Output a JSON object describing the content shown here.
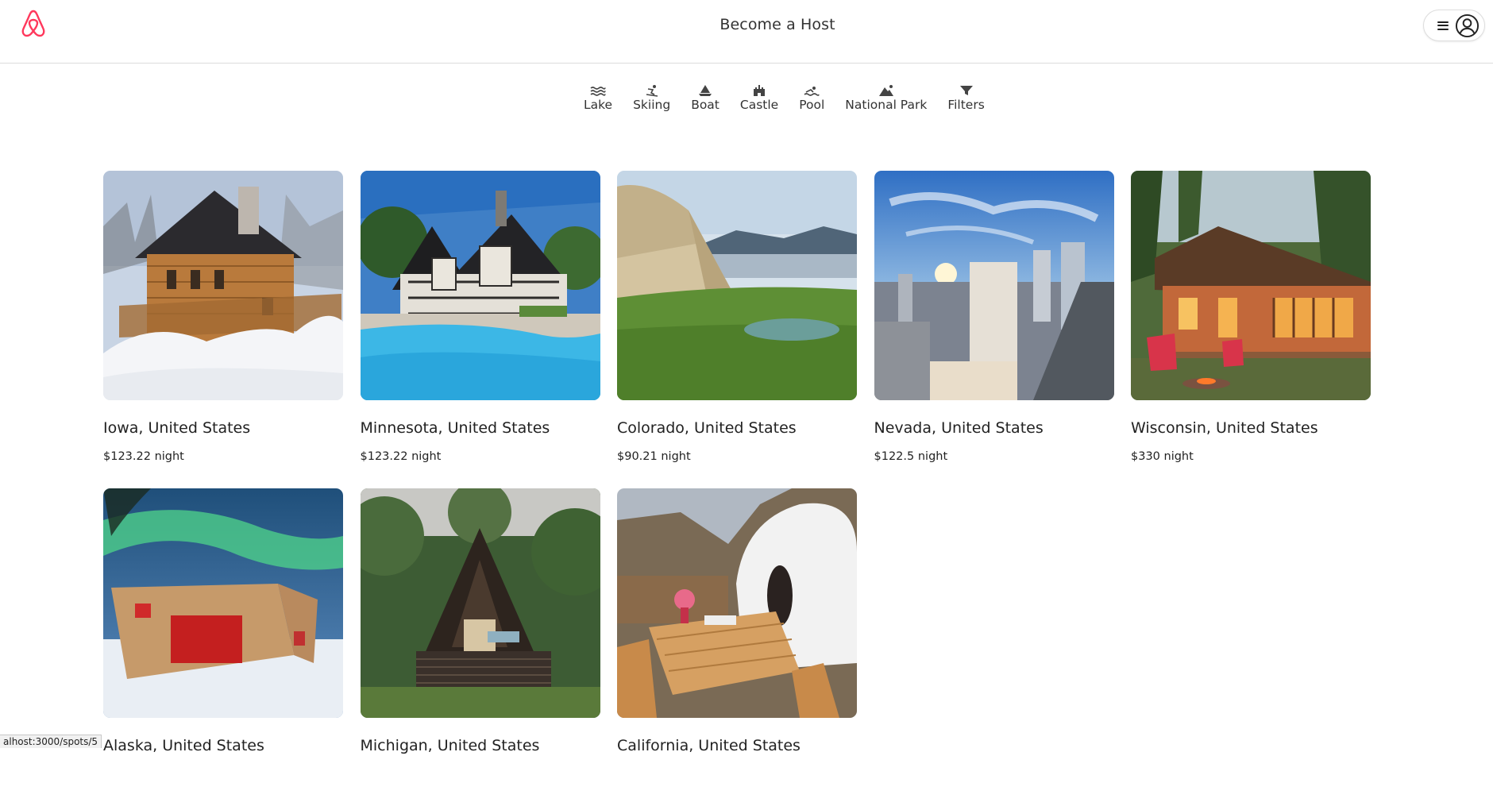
{
  "header": {
    "logo": "airbnb-logo",
    "host_link": "Become a Host"
  },
  "categories": [
    {
      "label": "Lake",
      "icon": "lake-icon"
    },
    {
      "label": "Skiing",
      "icon": "skiing-icon"
    },
    {
      "label": "Boat",
      "icon": "boat-icon"
    },
    {
      "label": "Castle",
      "icon": "castle-icon"
    },
    {
      "label": "Pool",
      "icon": "pool-icon"
    },
    {
      "label": "National Park",
      "icon": "national-park-icon"
    },
    {
      "label": "Filters",
      "icon": "filter-icon"
    }
  ],
  "listings": [
    {
      "location": "Iowa, United States",
      "price": "$123.22 night",
      "image": "snowy log cabin"
    },
    {
      "location": "Minnesota, United States",
      "price": "$123.22 night",
      "image": "tudor mansion with pool"
    },
    {
      "location": "Colorado, United States",
      "price": "$90.21 night",
      "image": "canvas tent by lake"
    },
    {
      "location": "Nevada, United States",
      "price": "$122.5 night",
      "image": "city skyline at sunset"
    },
    {
      "location": "Wisconsin, United States",
      "price": "$330 night",
      "image": "cabin with red chairs"
    },
    {
      "location": "Alaska, United States",
      "price": "",
      "image": "modern cabin under aurora"
    },
    {
      "location": "Michigan, United States",
      "price": "",
      "image": "a-frame cabin in woods"
    },
    {
      "location": "California, United States",
      "price": "",
      "image": "cave house patio"
    }
  ],
  "status_bar": "alhost:3000/spots/5",
  "colors": {
    "brand": "#ff385c",
    "text": "#222222",
    "border": "#dddddd"
  }
}
